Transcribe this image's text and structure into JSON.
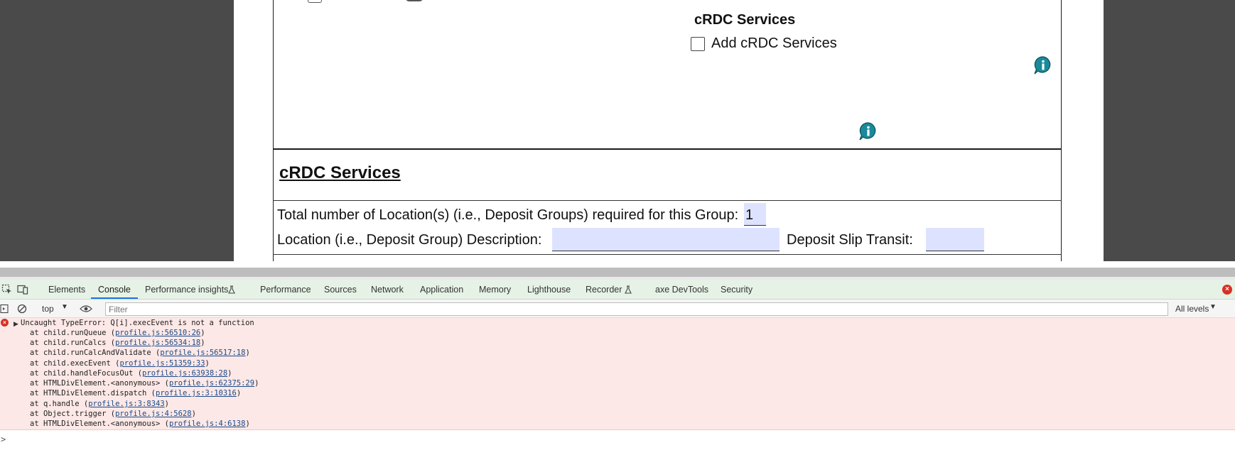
{
  "form": {
    "subheading": "cRDC Services",
    "add_checkbox_label": "Add cRDC Services",
    "section_title": "cRDC Services",
    "total_locations_label": "Total number of Location(s) (i.e., Deposit Groups) required for this Group:",
    "total_locations_value": "1",
    "location_description_label": "Location (i.e., Deposit Group) Description:",
    "location_description_value": "",
    "deposit_slip_label": "Deposit Slip Transit:",
    "deposit_slip_value": ""
  },
  "devtools": {
    "tabs": [
      {
        "label": "Elements"
      },
      {
        "label": "Console"
      },
      {
        "label": "Performance insights"
      },
      {
        "label": "Performance"
      },
      {
        "label": "Sources"
      },
      {
        "label": "Network"
      },
      {
        "label": "Application"
      },
      {
        "label": "Memory"
      },
      {
        "label": "Lighthouse"
      },
      {
        "label": "Recorder"
      },
      {
        "label": "axe DevTools"
      },
      {
        "label": "Security"
      }
    ],
    "active_tab": "Console",
    "context": "top",
    "filter_placeholder": "Filter",
    "levels": "All levels",
    "error": {
      "message": "Uncaught TypeError: Q[i].execEvent is not a function",
      "stack": [
        {
          "prefix": "at child.runQueue (",
          "link": "profile.js:56510:26",
          "suffix": ")"
        },
        {
          "prefix": "at child.runCalcs (",
          "link": "profile.js:56534:18",
          "suffix": ")"
        },
        {
          "prefix": "at child.runCalcAndValidate (",
          "link": "profile.js:56517:18",
          "suffix": ")"
        },
        {
          "prefix": "at child.execEvent (",
          "link": "profile.js:51359:33",
          "suffix": ")"
        },
        {
          "prefix": "at child.handleFocusOut (",
          "link": "profile.js:63938:28",
          "suffix": ")"
        },
        {
          "prefix": "at HTMLDivElement.<anonymous> (",
          "link": "profile.js:62375:29",
          "suffix": ")"
        },
        {
          "prefix": "at HTMLDivElement.dispatch (",
          "link": "profile.js:3:10316",
          "suffix": ")"
        },
        {
          "prefix": "at q.handle (",
          "link": "profile.js:3:8343",
          "suffix": ")"
        },
        {
          "prefix": "at Object.trigger (",
          "link": "profile.js:4:5628",
          "suffix": ")"
        },
        {
          "prefix": "at HTMLDivElement.<anonymous> (",
          "link": "profile.js:4:6138",
          "suffix": ")"
        }
      ]
    },
    "prompt": ">"
  },
  "colors": {
    "field_bg": "#dde3ff",
    "info_teal": "#1a8a9a",
    "error_bg": "#fce8e6",
    "tabbar_bg": "#e6f2e6"
  }
}
